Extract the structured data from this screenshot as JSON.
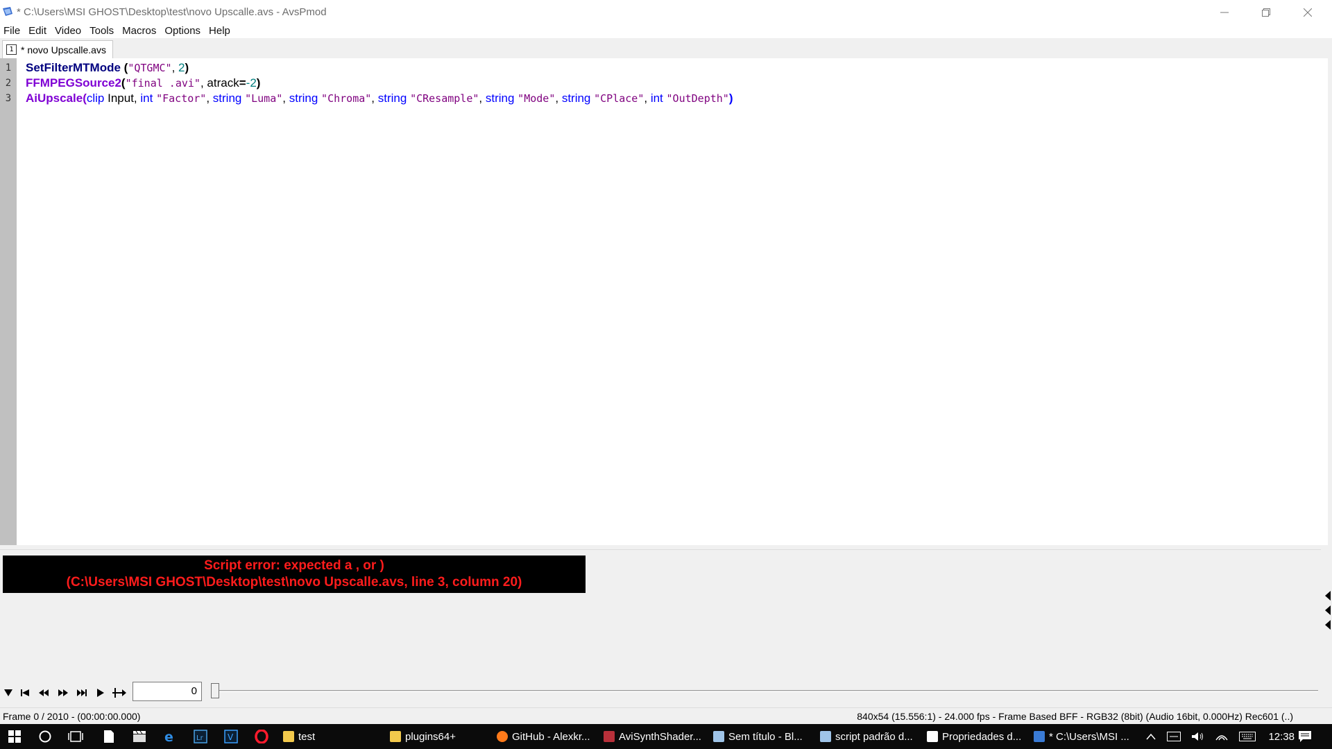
{
  "window": {
    "title": "* C:\\Users\\MSI GHOST\\Desktop\\test\\novo Upscalle.avs - AvsPmod"
  },
  "menu": [
    "File",
    "Edit",
    "Video",
    "Tools",
    "Macros",
    "Options",
    "Help"
  ],
  "tab": {
    "number": "1",
    "label": "* novo Upscalle.avs"
  },
  "editor": {
    "line_numbers": [
      "1",
      "2",
      "3"
    ],
    "line1": {
      "func": "SetFilterMTMode",
      "open": " (",
      "s1": "\"QTGMC\"",
      "comma": ", ",
      "n1": "2",
      "close": ")"
    },
    "line2": {
      "func": "FFMPEGSource2",
      "open": "(",
      "s1": "\"final .avi\"",
      "comma": ", ",
      "arg": "atrack",
      "eq": "=",
      "n1": "-2",
      "close": ")"
    },
    "line3": {
      "func": "AiUpscale",
      "open": "(",
      "t0": "clip",
      "a0": " Input, ",
      "t1": "int",
      "s1": "\"Factor\"",
      "c1": ", ",
      "t2": "string",
      "s2": "\"Luma\"",
      "c2": ", ",
      "t3": "string",
      "s3": "\"Chroma\"",
      "c3": ", ",
      "t4": "string",
      "s4": "\"CResample\"",
      "c4": ", ",
      "t5": "string",
      "s5": "\"Mode\"",
      "c5": ", ",
      "t6": "string",
      "s6": "\"CPlace\"",
      "c6": ", ",
      "t7": "int",
      "s7": "\"OutDepth\"",
      "close": ")"
    }
  },
  "error": {
    "line1": "Script error: expected a , or )",
    "line2": "(C:\\Users\\MSI GHOST\\Desktop\\test\\novo Upscalle.avs, line 3, column 20)",
    "color": "#ff1c1c"
  },
  "transport": {
    "frame_value": "0",
    "slider_position": 0
  },
  "status": {
    "left": "Frame 0 / 2010  -  (00:00:00.000)",
    "right": "840x54 (15.556:1) - 24.000 fps - Frame Based BFF - RGB32 (8bit) (Audio 16bit, 0.000Hz) Rec601 (..)"
  },
  "taskbar": {
    "tasks": [
      {
        "label": "test",
        "color": "#f2c94c"
      },
      {
        "label": "plugins64+",
        "color": "#f2c94c"
      },
      {
        "label": "GitHub - Alexkr...",
        "color": "#ff7a1a"
      },
      {
        "label": "AviSynthShader...",
        "color": "#b8303a"
      },
      {
        "label": "Sem título - Bl...",
        "color": "#9fc4e8"
      },
      {
        "label": "script padrão d...",
        "color": "#9fc4e8"
      },
      {
        "label": "Propriedades d...",
        "color": "#ffffff"
      },
      {
        "label": "* C:\\Users\\MSI ...",
        "color": "#3a7bd5"
      }
    ],
    "clock": "12:38"
  },
  "colors": {
    "func1": "#00007f",
    "func2": "#7f00d4",
    "type": "#0000ff",
    "string": "#7f007f",
    "number": "#007f7f"
  }
}
